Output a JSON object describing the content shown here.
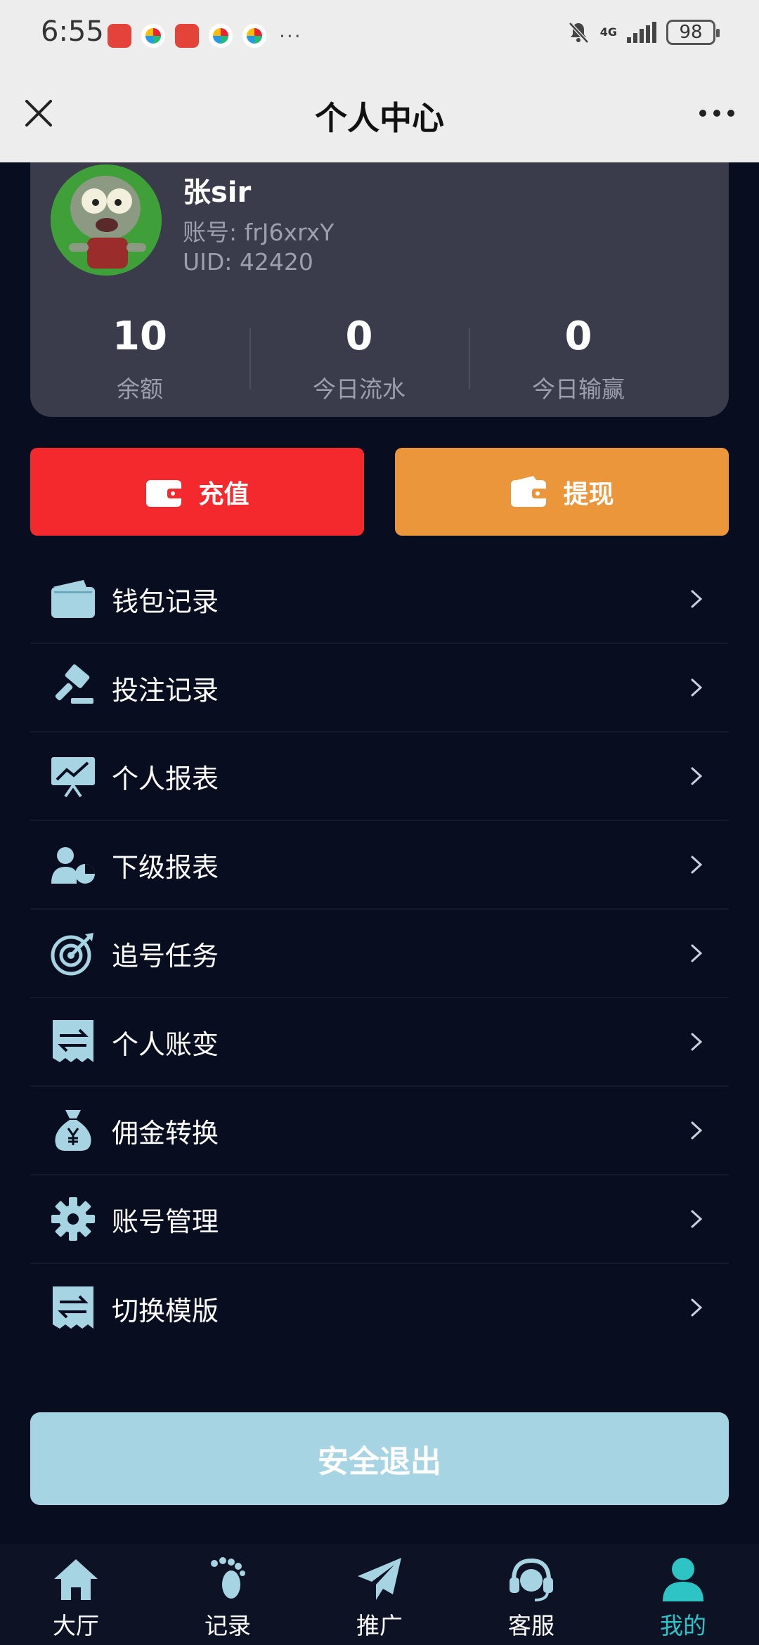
{
  "status_bar": {
    "time": "6:55",
    "more": "···",
    "network": "4G",
    "battery": "98"
  },
  "header": {
    "title": "个人中心"
  },
  "profile": {
    "username": "张sir",
    "account_label": "账号:",
    "account_value": "frJ6xrxY",
    "uid_label": "UID:",
    "uid_value": "42420",
    "stats": [
      {
        "value": "10",
        "label": "余额"
      },
      {
        "value": "0",
        "label": "今日流水"
      },
      {
        "value": "0",
        "label": "今日输赢"
      }
    ]
  },
  "actions": {
    "recharge": "充值",
    "withdraw": "提现"
  },
  "menu": [
    {
      "label": "钱包记录",
      "icon": "wallet-icon"
    },
    {
      "label": "投注记录",
      "icon": "gavel-icon"
    },
    {
      "label": "个人报表",
      "icon": "chart-board-icon"
    },
    {
      "label": "下级报表",
      "icon": "user-pie-icon"
    },
    {
      "label": "追号任务",
      "icon": "target-icon"
    },
    {
      "label": "个人账变",
      "icon": "receipt-exchange-icon"
    },
    {
      "label": "佣金转换",
      "icon": "money-bag-icon"
    },
    {
      "label": "账号管理",
      "icon": "gear-icon"
    },
    {
      "label": "切换模版",
      "icon": "receipt-exchange-icon"
    }
  ],
  "logout": "安全退出",
  "bottom_nav": [
    {
      "label": "大厅",
      "icon": "home-icon"
    },
    {
      "label": "记录",
      "icon": "footprint-icon"
    },
    {
      "label": "推广",
      "icon": "paper-plane-icon"
    },
    {
      "label": "客服",
      "icon": "headset-icon"
    },
    {
      "label": "我的",
      "icon": "user-icon",
      "active": true
    }
  ],
  "colors": {
    "background": "#080d1f",
    "card": "#3a3c4b",
    "recharge": "#f3292d",
    "withdraw": "#ec963b",
    "icon": "#a6d4e3",
    "active_tab": "#2ec4c6",
    "logout": "#a6d4e3"
  }
}
